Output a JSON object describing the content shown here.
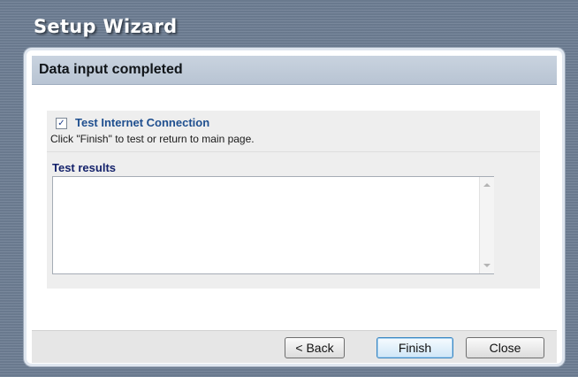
{
  "window": {
    "title": "Setup Wizard"
  },
  "panel": {
    "heading": "Data input completed"
  },
  "test_connection": {
    "label": "Test Internet Connection",
    "checked": true,
    "hint": "Click \"Finish\" to test or return to main page."
  },
  "results": {
    "label": "Test results",
    "value": ""
  },
  "buttons": {
    "back": "< Back",
    "finish": "Finish",
    "close": "Close"
  },
  "colors": {
    "title_text": "#ffffff",
    "header_band": "#c5cfdc",
    "link_blue": "#1f4f8f",
    "label_navy": "#14226b",
    "focus_border": "#3a86c2"
  },
  "icons": {
    "checkbox": "checkmark-icon",
    "scroll_up": "scroll-up-arrow-icon",
    "scroll_down": "scroll-down-arrow-icon"
  }
}
